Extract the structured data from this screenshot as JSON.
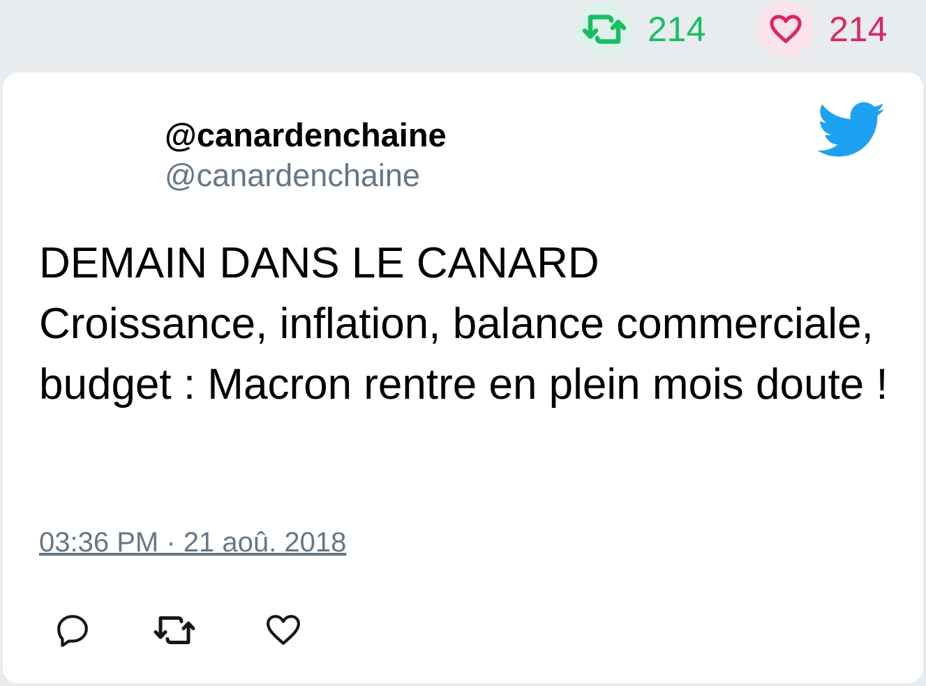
{
  "stats": {
    "retweets": "214",
    "likes": "214",
    "retweet_icon": "retweet-icon",
    "like_icon": "heart-icon",
    "retweet_color": "#17bf63",
    "like_color": "#e0245e"
  },
  "tweet": {
    "display_name": "@canardenchaine",
    "handle": "@canardenchaine",
    "text": "DEMAIN DANS LE CANARD\nCroissance, inflation, balance commerciale, budget : Macron rentre en plein mois doute !",
    "timestamp": "03:36 PM · 21 aoû. 2018",
    "brand_icon": "twitter-bird-icon",
    "brand_color": "#1da1f2"
  },
  "actions": {
    "reply_icon": "reply-icon",
    "retweet_icon": "retweet-icon",
    "like_icon": "heart-icon"
  }
}
